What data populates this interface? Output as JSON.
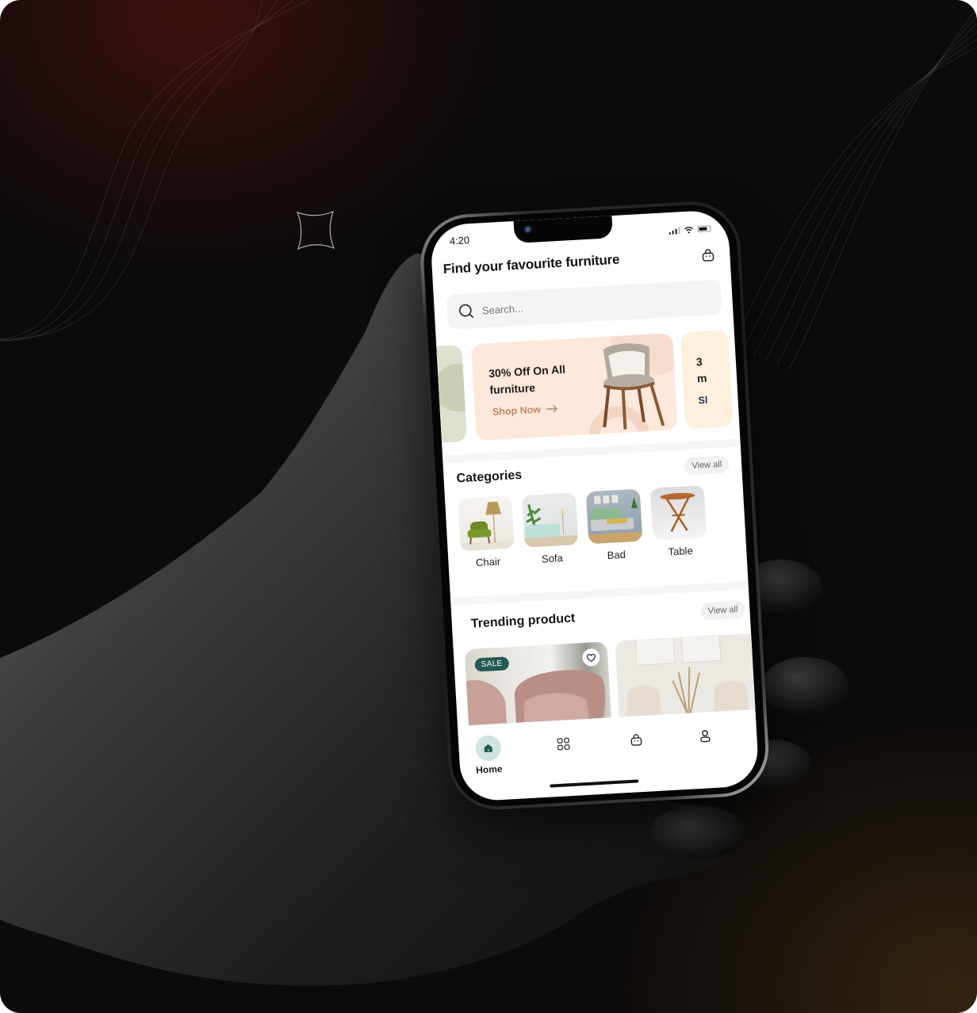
{
  "status_bar": {
    "time": "4:20"
  },
  "header": {
    "title": "Find your favourite furniture",
    "cart_icon": "shopping-bag-icon"
  },
  "search": {
    "placeholder": "Search...",
    "value": "",
    "icon": "search-icon"
  },
  "banners": {
    "main": {
      "title": "30% Off On All furniture",
      "title_line1": "30% Off On All",
      "title_line2": "furniture",
      "cta": "Shop Now",
      "cta_icon": "arrow-right-icon",
      "bg": "#FDE8DB",
      "cta_color": "#B98A67"
    },
    "next_peek": {
      "line1": "3",
      "line2": "m",
      "cta": "Sl",
      "bg": "#FDF0DC",
      "cta_color": "#24305E"
    },
    "prev_peek": {
      "bg": "#DDE2CF"
    }
  },
  "categories": {
    "title": "Categories",
    "view_all": "View all",
    "items": [
      {
        "label": "Chair"
      },
      {
        "label": "Sofa"
      },
      {
        "label": "Bad"
      },
      {
        "label": "Table"
      }
    ]
  },
  "trending": {
    "title": "Trending product",
    "view_all": "View all",
    "products": [
      {
        "badge": "SALE",
        "favorite_icon": "heart-icon"
      },
      {}
    ]
  },
  "tabbar": {
    "items": [
      {
        "label": "Home",
        "icon": "home-icon",
        "active": true
      },
      {
        "label": "",
        "icon": "grid-icon",
        "active": false
      },
      {
        "label": "",
        "icon": "shopping-bag-icon",
        "active": false
      },
      {
        "label": "",
        "icon": "user-icon",
        "active": false
      }
    ]
  },
  "colors": {
    "accent": "#245A54",
    "accent_light": "#CFE3E0",
    "background": "#0C0B0B"
  }
}
